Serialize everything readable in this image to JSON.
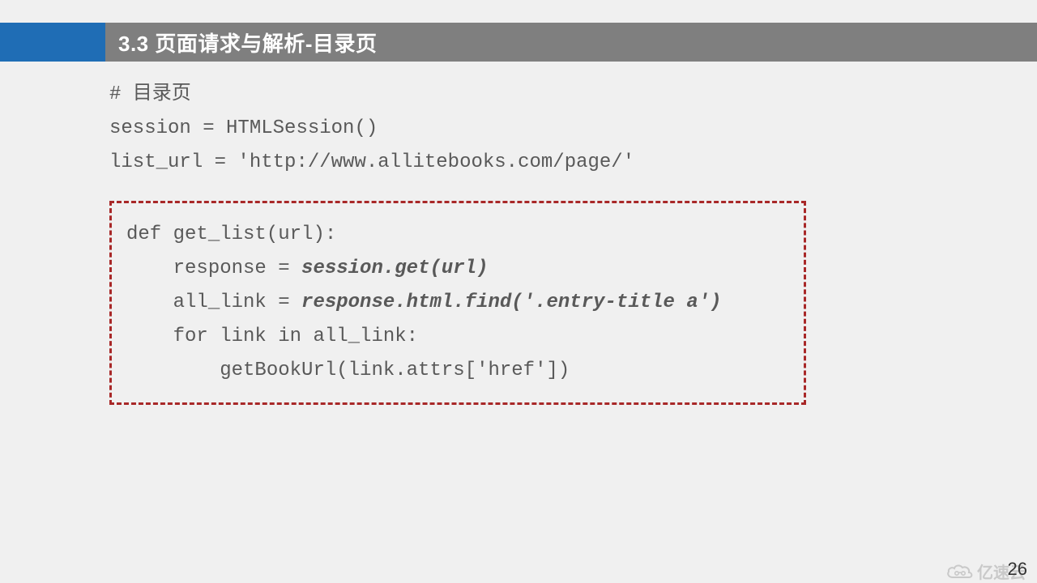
{
  "header": {
    "title": "3.3 页面请求与解析-目录页"
  },
  "code": {
    "line1": "# 目录页",
    "line2": "session = HTMLSession()",
    "line3": "list_url = 'http://www.allitebooks.com/page/'",
    "box": {
      "l1": "def get_list(url):",
      "l2a": "    response = ",
      "l2b": "session.get(url)",
      "l3a": "    all_link = ",
      "l3b": "response.html.find('.entry-title a')",
      "l4": "    for link in all_link:",
      "l5": "        getBookUrl(link.attrs['href'])"
    }
  },
  "page_number": "26",
  "watermark": "亿速云"
}
